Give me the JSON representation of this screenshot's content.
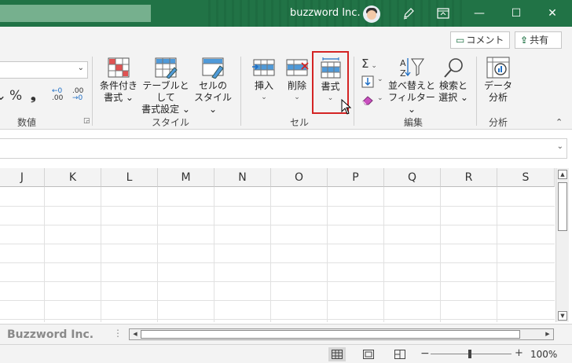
{
  "titlebar": {
    "title": "buzzword Inc.",
    "minimize": "—",
    "maximize": "☐",
    "close": "✕"
  },
  "comment_button": "コメント",
  "share_button": "共有",
  "groups": {
    "number": {
      "label": "数値",
      "percent": "%",
      "comma": "❟",
      "inc_top": "←0",
      "inc_bot": ".00",
      "dec_top": ".00",
      "dec_bot": "→0"
    },
    "styles": {
      "label": "スタイル",
      "conditional": [
        "条件付き",
        "書式 ⌄"
      ],
      "as_table": [
        "テーブルとして",
        "書式設定 ⌄"
      ],
      "cell_styles": [
        "セルの",
        "スタイル ⌄"
      ]
    },
    "cells": {
      "label": "セル",
      "insert": "挿入",
      "delete": "削除",
      "format": "書式",
      "chev": "⌄"
    },
    "editing": {
      "label": "編集",
      "sort": [
        "並べ替えと",
        "フィルター ⌄"
      ],
      "find": [
        "検索と",
        "選択 ⌄"
      ]
    },
    "analysis": {
      "label": "分析",
      "data_analysis": [
        "データ",
        "分析"
      ]
    }
  },
  "columns": [
    "J",
    "K",
    "L",
    "M",
    "N",
    "O",
    "P",
    "Q",
    "R",
    "S"
  ],
  "sheet_tab": "Buzzword Inc.",
  "zoom": "100%",
  "accent": "#217346",
  "selection_color": "#d42424"
}
